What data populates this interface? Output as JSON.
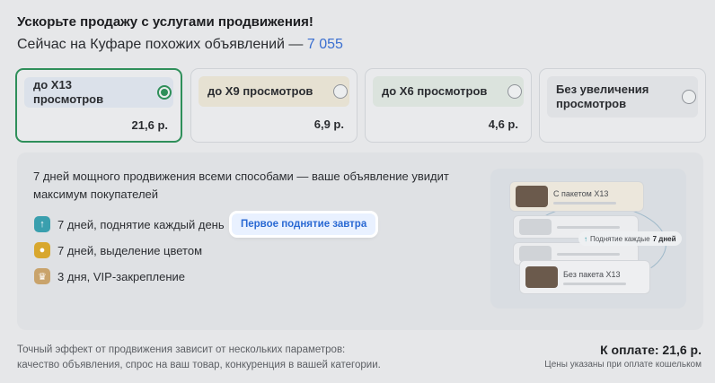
{
  "header": {
    "title": "Ускорьте продажу с услугами продвижения!",
    "subtitle_prefix": "Сейчас на Куфаре похожих объявлений — ",
    "similar_count": "7 055"
  },
  "options": [
    {
      "label": "до Х13 просмотров",
      "price": "21,6 р.",
      "selected": true,
      "pill_color": "#dbe1ea"
    },
    {
      "label": "до Х9 просмотров",
      "price": "6,9 р.",
      "selected": false,
      "pill_color": "#e6e1d2"
    },
    {
      "label": "до Х6 просмотров",
      "price": "4,6 р.",
      "selected": false,
      "pill_color": "#dbe3dd"
    },
    {
      "label": "Без увеличения просмотров",
      "price": "",
      "selected": false,
      "pill_color": "#dfe1e4"
    }
  ],
  "details": {
    "description": "7 дней мощного продвижения всеми способами — ваше объявление увидит максимум покупателей",
    "features": [
      {
        "text": "7 дней, поднятие каждый день",
        "icon": "lift-arrow-icon",
        "color": "#3a9fae"
      },
      {
        "text": "7 дней, выделение цветом",
        "icon": "highlight-color-icon",
        "color": "#d8a72e"
      },
      {
        "text": "3 дня, VIP-закрепление",
        "icon": "crown-icon",
        "color": "#c9a36b"
      }
    ],
    "tooltip": "Первое поднятие завтра"
  },
  "illustration": {
    "with_package": "С пакетом Х13",
    "lift_badge_prefix": "Поднятие каждые",
    "lift_badge_value": "7 дней",
    "without_package": "Без пакета Х13"
  },
  "footer": {
    "note_line1": "Точный эффект от продвижения зависит от нескольких параметров:",
    "note_line2": "качество объявления, спрос на ваш товар, конкуренция в вашей категории.",
    "total": "К оплате: 21,6 р.",
    "total_note": "Цены указаны при оплате кошельком"
  },
  "colors": {
    "accent_green": "#2f8f5a",
    "link_blue": "#3a6fd0"
  }
}
